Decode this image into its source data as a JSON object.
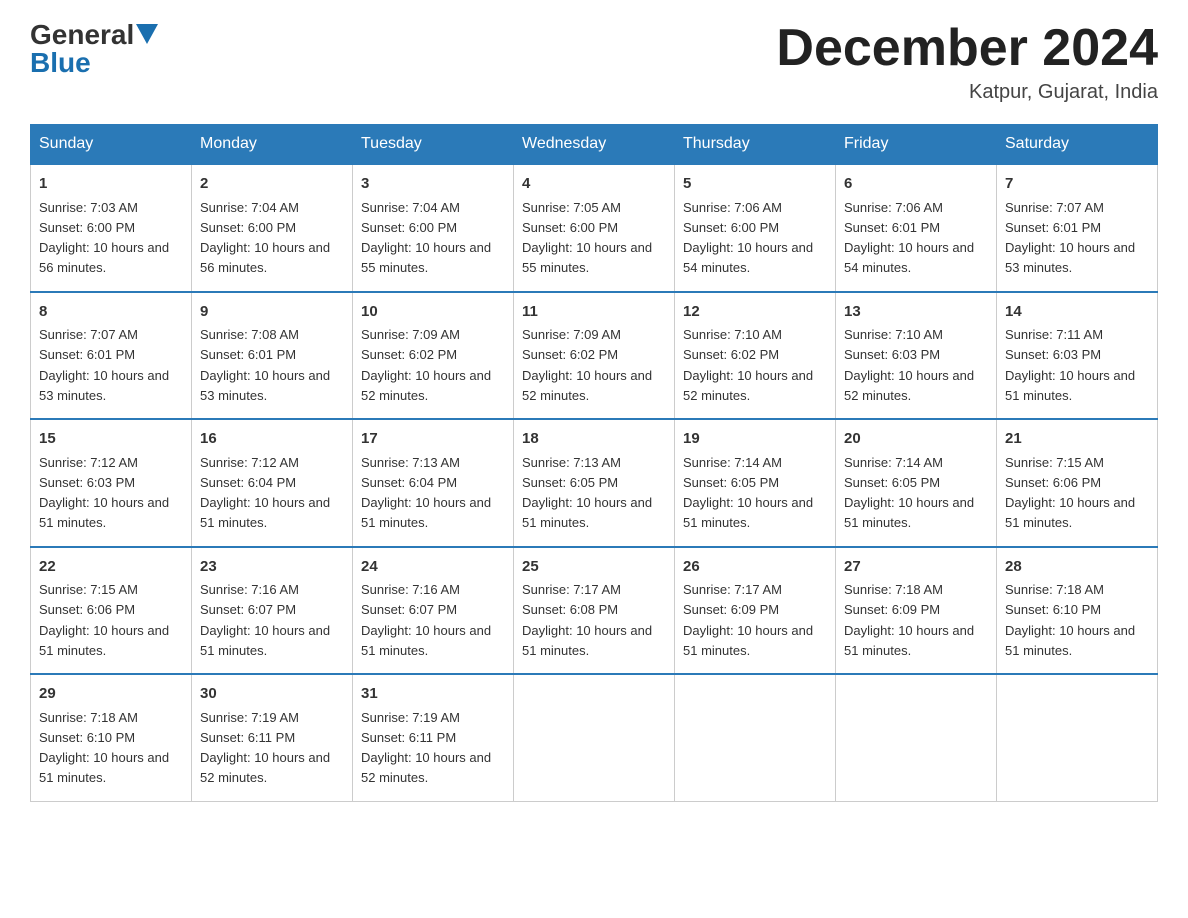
{
  "header": {
    "logo_general": "General",
    "logo_blue": "Blue",
    "month_title": "December 2024",
    "location": "Katpur, Gujarat, India"
  },
  "days_of_week": [
    "Sunday",
    "Monday",
    "Tuesday",
    "Wednesday",
    "Thursday",
    "Friday",
    "Saturday"
  ],
  "weeks": [
    [
      {
        "day": "1",
        "sunrise": "7:03 AM",
        "sunset": "6:00 PM",
        "daylight": "10 hours and 56 minutes."
      },
      {
        "day": "2",
        "sunrise": "7:04 AM",
        "sunset": "6:00 PM",
        "daylight": "10 hours and 56 minutes."
      },
      {
        "day": "3",
        "sunrise": "7:04 AM",
        "sunset": "6:00 PM",
        "daylight": "10 hours and 55 minutes."
      },
      {
        "day": "4",
        "sunrise": "7:05 AM",
        "sunset": "6:00 PM",
        "daylight": "10 hours and 55 minutes."
      },
      {
        "day": "5",
        "sunrise": "7:06 AM",
        "sunset": "6:00 PM",
        "daylight": "10 hours and 54 minutes."
      },
      {
        "day": "6",
        "sunrise": "7:06 AM",
        "sunset": "6:01 PM",
        "daylight": "10 hours and 54 minutes."
      },
      {
        "day": "7",
        "sunrise": "7:07 AM",
        "sunset": "6:01 PM",
        "daylight": "10 hours and 53 minutes."
      }
    ],
    [
      {
        "day": "8",
        "sunrise": "7:07 AM",
        "sunset": "6:01 PM",
        "daylight": "10 hours and 53 minutes."
      },
      {
        "day": "9",
        "sunrise": "7:08 AM",
        "sunset": "6:01 PM",
        "daylight": "10 hours and 53 minutes."
      },
      {
        "day": "10",
        "sunrise": "7:09 AM",
        "sunset": "6:02 PM",
        "daylight": "10 hours and 52 minutes."
      },
      {
        "day": "11",
        "sunrise": "7:09 AM",
        "sunset": "6:02 PM",
        "daylight": "10 hours and 52 minutes."
      },
      {
        "day": "12",
        "sunrise": "7:10 AM",
        "sunset": "6:02 PM",
        "daylight": "10 hours and 52 minutes."
      },
      {
        "day": "13",
        "sunrise": "7:10 AM",
        "sunset": "6:03 PM",
        "daylight": "10 hours and 52 minutes."
      },
      {
        "day": "14",
        "sunrise": "7:11 AM",
        "sunset": "6:03 PM",
        "daylight": "10 hours and 51 minutes."
      }
    ],
    [
      {
        "day": "15",
        "sunrise": "7:12 AM",
        "sunset": "6:03 PM",
        "daylight": "10 hours and 51 minutes."
      },
      {
        "day": "16",
        "sunrise": "7:12 AM",
        "sunset": "6:04 PM",
        "daylight": "10 hours and 51 minutes."
      },
      {
        "day": "17",
        "sunrise": "7:13 AM",
        "sunset": "6:04 PM",
        "daylight": "10 hours and 51 minutes."
      },
      {
        "day": "18",
        "sunrise": "7:13 AM",
        "sunset": "6:05 PM",
        "daylight": "10 hours and 51 minutes."
      },
      {
        "day": "19",
        "sunrise": "7:14 AM",
        "sunset": "6:05 PM",
        "daylight": "10 hours and 51 minutes."
      },
      {
        "day": "20",
        "sunrise": "7:14 AM",
        "sunset": "6:05 PM",
        "daylight": "10 hours and 51 minutes."
      },
      {
        "day": "21",
        "sunrise": "7:15 AM",
        "sunset": "6:06 PM",
        "daylight": "10 hours and 51 minutes."
      }
    ],
    [
      {
        "day": "22",
        "sunrise": "7:15 AM",
        "sunset": "6:06 PM",
        "daylight": "10 hours and 51 minutes."
      },
      {
        "day": "23",
        "sunrise": "7:16 AM",
        "sunset": "6:07 PM",
        "daylight": "10 hours and 51 minutes."
      },
      {
        "day": "24",
        "sunrise": "7:16 AM",
        "sunset": "6:07 PM",
        "daylight": "10 hours and 51 minutes."
      },
      {
        "day": "25",
        "sunrise": "7:17 AM",
        "sunset": "6:08 PM",
        "daylight": "10 hours and 51 minutes."
      },
      {
        "day": "26",
        "sunrise": "7:17 AM",
        "sunset": "6:09 PM",
        "daylight": "10 hours and 51 minutes."
      },
      {
        "day": "27",
        "sunrise": "7:18 AM",
        "sunset": "6:09 PM",
        "daylight": "10 hours and 51 minutes."
      },
      {
        "day": "28",
        "sunrise": "7:18 AM",
        "sunset": "6:10 PM",
        "daylight": "10 hours and 51 minutes."
      }
    ],
    [
      {
        "day": "29",
        "sunrise": "7:18 AM",
        "sunset": "6:10 PM",
        "daylight": "10 hours and 51 minutes."
      },
      {
        "day": "30",
        "sunrise": "7:19 AM",
        "sunset": "6:11 PM",
        "daylight": "10 hours and 52 minutes."
      },
      {
        "day": "31",
        "sunrise": "7:19 AM",
        "sunset": "6:11 PM",
        "daylight": "10 hours and 52 minutes."
      },
      null,
      null,
      null,
      null
    ]
  ]
}
